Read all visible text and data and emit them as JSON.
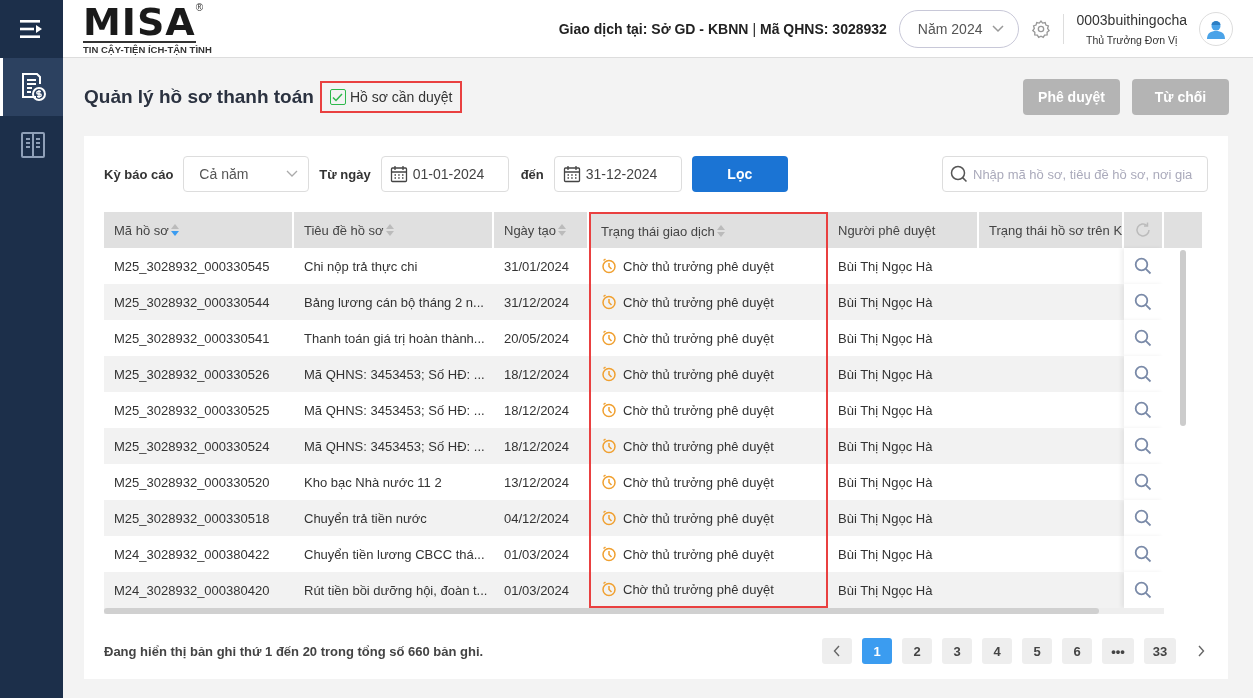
{
  "sidebar": {
    "items": [
      {
        "kind": "payment",
        "selected": true
      },
      {
        "kind": "book",
        "selected": false
      }
    ]
  },
  "header": {
    "logo": {
      "name": "MISA",
      "tagline": "TIN CẬY-TIỆN ÍCH-TẬN TÌNH",
      "mark": "®"
    },
    "transaction_place": "Giao dịch tại: Sở GD - KBNN",
    "separator": "|",
    "unit_code": "Mã QHNS: 3028932",
    "year": "Năm 2024",
    "user": {
      "name": "0003buithingocha",
      "role": "Thủ Trưởng Đơn Vị"
    }
  },
  "page": {
    "title": "Quản lý hồ sơ thanh toán",
    "filter_checkbox": {
      "label": "Hồ sơ cần duyệt",
      "checked": true,
      "highlighted": true
    },
    "buttons": [
      {
        "label": "Phê duyệt",
        "disabled": true
      },
      {
        "label": "Từ chối",
        "disabled": true
      }
    ]
  },
  "filters": {
    "period_label": "Kỳ báo cáo",
    "period": "Cả năm",
    "from_label": "Từ ngày",
    "from": "01-01-2024",
    "to_label": "đến",
    "to": "31-12-2024",
    "apply": "Lọc",
    "search_placeholder": "Nhập mã hồ sơ, tiêu đề hồ sơ, nơi gia"
  },
  "table": {
    "columns": [
      {
        "label": "Mã hồ sơ",
        "sortable": true,
        "sorted": true,
        "highlighted": false
      },
      {
        "label": "Tiêu đề hồ sơ",
        "sortable": true,
        "sorted": false,
        "highlighted": false
      },
      {
        "label": "Ngày tạo",
        "sortable": true,
        "sorted": false,
        "highlighted": false
      },
      {
        "label": "Trạng thái giao dịch",
        "sortable": true,
        "sorted": false,
        "highlighted": true
      },
      {
        "label": "Người phê duyệt",
        "highlighted": false
      },
      {
        "label": "Trạng thái hồ sơ trên K",
        "highlighted": false
      }
    ],
    "rows": [
      {
        "code": "M25_3028932_000330545",
        "title": "Chi nộp trả thực chi",
        "date": "31/01/2024",
        "status": "Chờ thủ trưởng phê duyệt",
        "approver": "Bùi Thị Ngọc Hà"
      },
      {
        "code": "M25_3028932_000330544",
        "title": "Bảng lương cán bộ tháng 2 n...",
        "date": "31/12/2024",
        "status": "Chờ thủ trưởng phê duyệt",
        "approver": "Bùi Thị Ngọc Hà"
      },
      {
        "code": "M25_3028932_000330541",
        "title": "Thanh toán giá trị hoàn thành...",
        "date": "20/05/2024",
        "status": "Chờ thủ trưởng phê duyệt",
        "approver": "Bùi Thị Ngọc Hà"
      },
      {
        "code": "M25_3028932_000330526",
        "title": "Mã QHNS: 3453453; Số HĐ: ...",
        "date": "18/12/2024",
        "status": "Chờ thủ trưởng phê duyệt",
        "approver": "Bùi Thị Ngọc Hà"
      },
      {
        "code": "M25_3028932_000330525",
        "title": "Mã QHNS: 3453453; Số HĐ: ...",
        "date": "18/12/2024",
        "status": "Chờ thủ trưởng phê duyệt",
        "approver": "Bùi Thị Ngọc Hà"
      },
      {
        "code": "M25_3028932_000330524",
        "title": "Mã QHNS: 3453453; Số HĐ: ...",
        "date": "18/12/2024",
        "status": "Chờ thủ trưởng phê duyệt",
        "approver": "Bùi Thị Ngọc Hà"
      },
      {
        "code": "M25_3028932_000330520",
        "title": "Kho bạc Nhà nước 11 2",
        "date": "13/12/2024",
        "status": "Chờ thủ trưởng phê duyệt",
        "approver": "Bùi Thị Ngọc Hà"
      },
      {
        "code": "M25_3028932_000330518",
        "title": "Chuyển trả tiền nước",
        "date": "04/12/2024",
        "status": "Chờ thủ trưởng phê duyệt",
        "approver": "Bùi Thị Ngọc Hà"
      },
      {
        "code": "M24_3028932_000380422",
        "title": "Chuyển tiền lương CBCC thá...",
        "date": "01/03/2024",
        "status": "Chờ thủ trưởng phê duyệt",
        "approver": "Bùi Thị Ngọc Hà"
      },
      {
        "code": "M24_3028932_000380420",
        "title": "Rút tiền bồi dưỡng hội, đoàn t...",
        "date": "01/03/2024",
        "status": "Chờ thủ trưởng phê duyệt",
        "approver": "Bùi Thị Ngọc Hà"
      }
    ]
  },
  "footer": {
    "summary": "Đang hiển thị bản ghi thứ 1 đến 20 trong tổng số 660 bản ghi.",
    "pages": [
      {
        "label": "1",
        "selected": true
      },
      {
        "label": "2",
        "selected": false
      },
      {
        "label": "3",
        "selected": false
      },
      {
        "label": "4",
        "selected": false
      },
      {
        "label": "5",
        "selected": false
      },
      {
        "label": "6",
        "selected": false
      },
      {
        "label": "•••",
        "selected": false
      },
      {
        "label": "33",
        "selected": false
      }
    ]
  }
}
